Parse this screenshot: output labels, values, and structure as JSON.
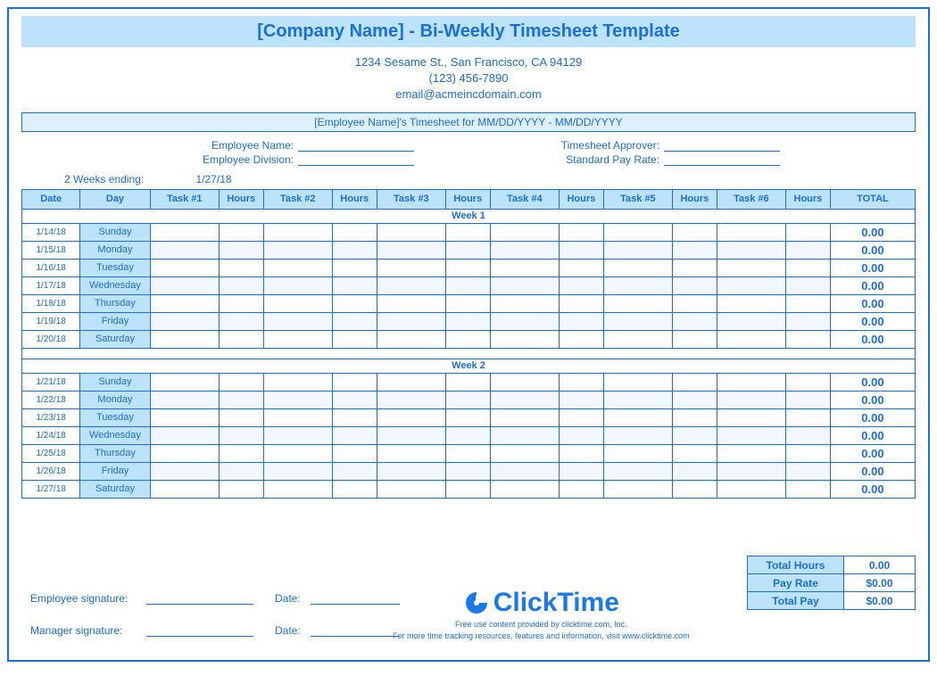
{
  "header": {
    "title": "[Company Name] - Bi-Weekly Timesheet Template",
    "address": "1234 Sesame St.,  San Francisco, CA 94129",
    "phone": "(123) 456-7890",
    "email": "email@acmeincdomain.com",
    "timesheet_for": "[Employee Name]'s Timesheet for MM/DD/YYYY - MM/DD/YYYY"
  },
  "fields": {
    "employee_name_label": "Employee Name:",
    "employee_division_label": "Employee Division:",
    "timesheet_approver_label": "Timesheet Approver:",
    "standard_pay_rate_label": "Standard Pay Rate:",
    "weeks_ending_label": "2 Weeks ending:",
    "weeks_ending_value": "1/27/18"
  },
  "columns": [
    "Date",
    "Day",
    "Task #1",
    "Hours",
    "Task #2",
    "Hours",
    "Task #3",
    "Hours",
    "Task #4",
    "Hours",
    "Task #5",
    "Hours",
    "Task #6",
    "Hours",
    "TOTAL"
  ],
  "week1_label": "Week 1",
  "week2_label": "Week 2",
  "week1": [
    {
      "date": "1/14/18",
      "day": "Sunday",
      "total": "0.00"
    },
    {
      "date": "1/15/18",
      "day": "Monday",
      "total": "0.00"
    },
    {
      "date": "1/16/18",
      "day": "Tuesday",
      "total": "0.00"
    },
    {
      "date": "1/17/18",
      "day": "Wednesday",
      "total": "0.00"
    },
    {
      "date": "1/18/18",
      "day": "Thursday",
      "total": "0.00"
    },
    {
      "date": "1/19/18",
      "day": "Friday",
      "total": "0.00"
    },
    {
      "date": "1/20/18",
      "day": "Saturday",
      "total": "0.00"
    }
  ],
  "week2": [
    {
      "date": "1/21/18",
      "day": "Sunday",
      "total": "0.00"
    },
    {
      "date": "1/22/18",
      "day": "Monday",
      "total": "0.00"
    },
    {
      "date": "1/23/18",
      "day": "Tuesday",
      "total": "0.00"
    },
    {
      "date": "1/24/18",
      "day": "Wednesday",
      "total": "0.00"
    },
    {
      "date": "1/25/18",
      "day": "Thursday",
      "total": "0.00"
    },
    {
      "date": "1/26/18",
      "day": "Friday",
      "total": "0.00"
    },
    {
      "date": "1/27/18",
      "day": "Saturday",
      "total": "0.00"
    }
  ],
  "summary": {
    "total_hours_label": "Total Hours",
    "total_hours_value": "0.00",
    "pay_rate_label": "Pay Rate",
    "pay_rate_value": "$0.00",
    "total_pay_label": "Total Pay",
    "total_pay_value": "$0.00"
  },
  "signatures": {
    "employee_label": "Employee signature:",
    "manager_label": "Manager signature:",
    "date_label": "Date:"
  },
  "footer": {
    "logo_text": "ClickTime",
    "line1": "Free use content provided by clicktime.com, Inc.",
    "line2": "For more time tracking resources, features and information, visit www.clicktime.com"
  }
}
